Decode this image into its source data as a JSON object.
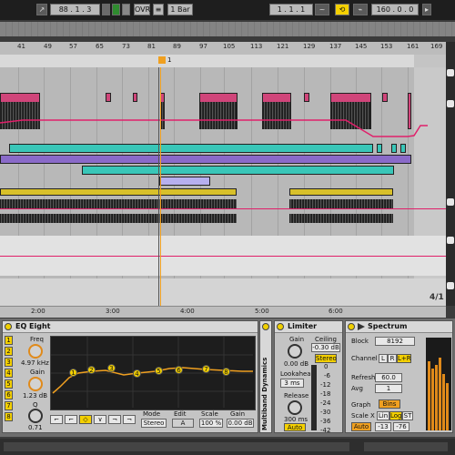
{
  "transport": {
    "tempo_field": "88 . 1 . 3",
    "ovr_label": "OVR",
    "quantize": "1 Bar",
    "arrangement_pos": "1 . 1 . 1",
    "loop_length": "160 . 0 . 0"
  },
  "ruler": {
    "bars": [
      "41",
      "49",
      "57",
      "65",
      "73",
      "81",
      "89",
      "97",
      "105",
      "113",
      "121",
      "129",
      "137",
      "145",
      "153",
      "161",
      "169"
    ],
    "marker": "1",
    "time_marks": [
      "2:00",
      "3:00",
      "4:00",
      "5:00",
      "6:00"
    ],
    "zoom_ratio": "4/1"
  },
  "eq_eight": {
    "title": "EQ Eight",
    "freq_label": "Freq",
    "freq_value": "4.97 kHz",
    "gain_label": "Gain",
    "gain_value": "1.23 dB",
    "q_label": "Q",
    "q_value": "0.71",
    "band_numbers": [
      "1",
      "2",
      "3",
      "4",
      "5",
      "6",
      "7",
      "8"
    ],
    "bands": [
      "1",
      "2",
      "3",
      "4",
      "5",
      "6",
      "7",
      "8"
    ],
    "mode_label": "Mode",
    "mode_value": "Stereo",
    "edit_label": "Edit",
    "edit_value": "A",
    "scale_label": "Scale",
    "scale_value": "100 %",
    "gain2_label": "Gain",
    "gain2_value": "0.00 dB"
  },
  "multiband": {
    "title": "Multiband Dynamics"
  },
  "limiter": {
    "title": "Limiter",
    "gain_label": "Gain",
    "gain_value": "0.00 dB",
    "ceiling_label": "Ceiling",
    "ceiling_value": "-0.30 dB",
    "stereo_label": "Stereo",
    "lookahead_label": "Lookahead",
    "lookahead_value": "3 ms",
    "release_label": "Release",
    "release_value": "300 ms",
    "auto_label": "Auto",
    "meter_scale": [
      "0",
      "-6",
      "-12",
      "-18",
      "-24",
      "-30",
      "-36",
      "-42"
    ]
  },
  "spectrum": {
    "title": "Spectrum",
    "block_label": "Block",
    "block_value": "8192",
    "channel_label": "Channel",
    "channel_opts": [
      "L",
      "R",
      "L+R"
    ],
    "refresh_label": "Refresh",
    "refresh_value": "60.0 ms",
    "avg_label": "Avg",
    "avg_value": "1",
    "graph_label": "Graph",
    "graph_value": "Bins",
    "scalex_label": "Scale X",
    "scalex_opts": [
      "Lin",
      "Log",
      "ST"
    ],
    "auto_label": "Auto",
    "range_lo": "-13",
    "range_hi": "-76"
  },
  "colors": {
    "accent_yellow": "#f4d000",
    "audio_pink": "#d0457a",
    "teal": "#39c6b8",
    "purple": "#8a6ac9",
    "lavender": "#b7b0ee",
    "automation": "#e0206a"
  }
}
